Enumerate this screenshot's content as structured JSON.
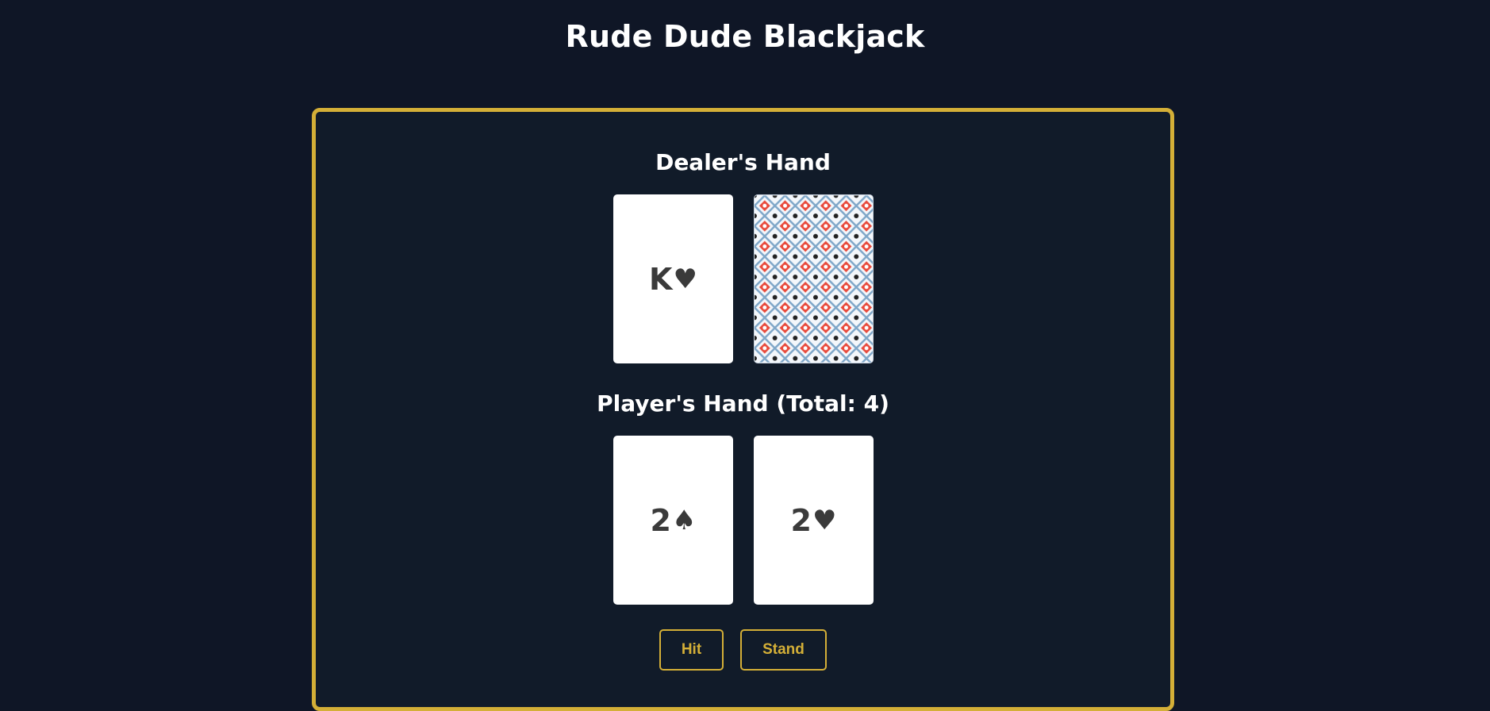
{
  "header": {
    "title": "Rude Dude Blackjack"
  },
  "dealer": {
    "title": "Dealer's Hand",
    "cards": [
      {
        "rank": "K",
        "suit": "♥",
        "face_up": true
      },
      {
        "face_up": false,
        "back_pattern": "card-back-pattern"
      }
    ]
  },
  "player": {
    "title": "Player's Hand (Total: 4)",
    "total": 4,
    "cards": [
      {
        "rank": "2",
        "suit": "♠",
        "face_up": true
      },
      {
        "rank": "2",
        "suit": "♥",
        "face_up": true
      }
    ]
  },
  "controls": {
    "hit_label": "Hit",
    "stand_label": "Stand"
  },
  "colors": {
    "background": "#0f1626",
    "table": "#111b29",
    "accent": "#d4af37",
    "card_text": "#3a3a3a",
    "card_back_red": "#e84a3c",
    "card_back_blue": "#7ea6c8"
  }
}
